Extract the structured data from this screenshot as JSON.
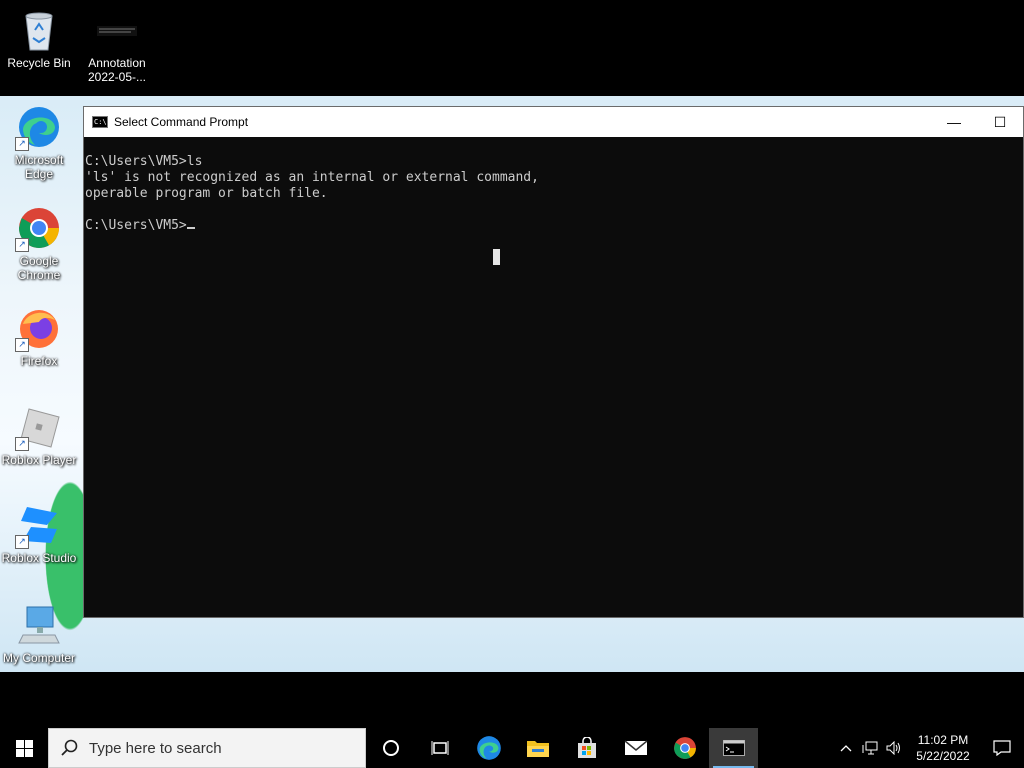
{
  "desktop": {
    "icons": [
      {
        "label": "Recycle Bin"
      },
      {
        "label": "Annotation\n2022-05-..."
      },
      {
        "label": "Microsoft\nEdge"
      },
      {
        "label": "Google\nChrome"
      },
      {
        "label": "Firefox"
      },
      {
        "label": "Roblox Player"
      },
      {
        "label": "Roblox Studio"
      },
      {
        "label": "My Computer"
      }
    ]
  },
  "window": {
    "title": "Select Command Prompt",
    "app_icon_text": "C:\\",
    "minimize_glyph": "—",
    "maximize_glyph": "☐",
    "console_lines": [
      "C:\\Users\\VM5>ls",
      "'ls' is not recognized as an internal or external command,",
      "operable program or batch file.",
      "",
      "C:\\Users\\VM5>"
    ]
  },
  "taskbar": {
    "search_placeholder": "Type here to search",
    "apps": [
      {
        "icon": "cortana-icon"
      },
      {
        "icon": "task-view-icon"
      },
      {
        "icon": "edge-icon"
      },
      {
        "icon": "file-explorer-icon"
      },
      {
        "icon": "store-icon"
      },
      {
        "icon": "mail-icon"
      },
      {
        "icon": "chrome-icon"
      },
      {
        "icon": "command-prompt-icon"
      }
    ],
    "clock_time": "11:02 PM",
    "clock_date": "5/22/2022"
  }
}
